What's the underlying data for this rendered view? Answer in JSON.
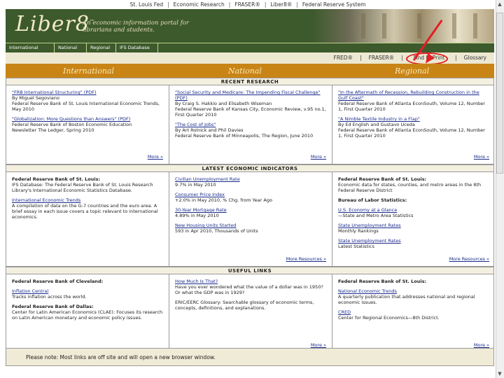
{
  "topnav": {
    "items": [
      "St. Louis Fed",
      "Economic Research",
      "FRASER®",
      "Liber8®",
      "Federal Reserve System"
    ]
  },
  "banner": {
    "logo": "Liber8",
    "logo_mark": "™",
    "tagline": "An economic information portal for librarians and students."
  },
  "tabs": [
    "International",
    "National",
    "Regional",
    "IFS Database"
  ],
  "subnav": {
    "items": [
      "FRED®",
      "FRASER®",
      "Find In Print",
      "Glossary"
    ],
    "separator": "|"
  },
  "columns": [
    "International",
    "National",
    "Regional"
  ],
  "sections": [
    {
      "title": "RECENT RESEARCH",
      "more": "More »",
      "cols": [
        [
          {
            "link": "\"FRB International Structuring\" (PDF)",
            "lines": [
              "By Miguel Segoviano",
              "Federal Reserve Bank of St. Louis International Economic Trends, May 2010"
            ]
          },
          {
            "link": "\"Globalization: More Questions than Answers\" (PDF)",
            "lines": [
              "Federal Reserve Bank of Boston Economic Education",
              "Newsletter The Ledger, Spring 2010"
            ]
          }
        ],
        [
          {
            "link": "\"Social Security and Medicare: The Impending Fiscal Challenge\" (PDF)",
            "lines": [
              "By Craig S. Hakkio and Elisabeth Wiseman",
              "Federal Reserve Bank of Kansas City, Economic Review, v.95 no.1, First Quarter 2010"
            ]
          },
          {
            "link": "\"The Cost of Jobs\"",
            "lines": [
              "By Art Rolnick and Phil Davies",
              "Federal Reserve Bank of Minneapolis, The Region, June 2010"
            ]
          }
        ],
        [
          {
            "link": "\"In the Aftermath of Recession, Rebuilding Construction in the Gulf Coast\"",
            "lines": [
              "Federal Reserve Bank of Atlanta EconSouth, Volume 12, Number 1, First Quarter 2010"
            ]
          },
          {
            "link": "\"A Nimble Textile Industry in a Flap\"",
            "lines": [
              "By Ed English and Gustavo Uceda",
              "Federal Reserve Bank of Atlanta EconSouth, Volume 12, Number 1, First Quarter 2010"
            ]
          }
        ]
      ]
    },
    {
      "title": "LATEST ECONOMIC INDICATORS",
      "more": "More Resources »",
      "cols": [
        [
          {
            "head": "Federal Reserve Bank of St. Louis:",
            "lines": [
              "IFS Database: The Federal Reserve Bank of St. Louis Research Library's International Economic Statistics Database."
            ]
          },
          {
            "link": "International Economic Trends",
            "lines": [
              "A compilation of data on the G-7 countries and the euro area. A brief essay in each issue covers a topic relevant to international economics."
            ]
          }
        ],
        [
          {
            "link": "Civilian Unemployment Rate",
            "lines": [
              "9.7% in May 2010"
            ]
          },
          {
            "link": "Consumer Price Index",
            "lines": [
              "+2.0% in May 2010, % Chg. from Year Ago"
            ]
          },
          {
            "link": "30-Year Mortgage Rate",
            "lines": [
              "4.89% in May 2010"
            ]
          },
          {
            "link": "New Housing Units Started",
            "lines": [
              "593 in Apr 2010, Thousands of Units"
            ]
          }
        ],
        [
          {
            "head": "Federal Reserve Bank of St. Louis:",
            "lines": [
              "Economic data for states, counties, and metro areas in the 8th Federal Reserve District"
            ]
          },
          {
            "head": "Bureau of Labor Statistics:",
            "lines": []
          },
          {
            "link": "U.S. Economy at a Glance",
            "lines": [
              "—State and Metro Area Statistics"
            ]
          },
          {
            "link": "State Unemployment Rates",
            "lines": [
              "Monthly Rankings"
            ]
          },
          {
            "link": "State Unemployment Rates",
            "lines": [
              "Latest Statistics"
            ]
          }
        ]
      ]
    },
    {
      "title": "USEFUL LINKS",
      "more": "More »",
      "cols": [
        [
          {
            "head": "Federal Reserve Bank of Cleveland:",
            "lines": []
          },
          {
            "link": "Inflation Central",
            "lines": [
              "Tracks inflation across the world."
            ]
          },
          {
            "head": "Federal Reserve Bank of Dallas:",
            "lines": [
              "Center for Latin American Economics (CLAE): Focuses its research on Latin American monetary and economic policy issues."
            ]
          }
        ],
        [
          {
            "link": "How Much Is That?",
            "lines": [
              "Have you ever wondered what the value of a dollar was in 1950? Or what the GDP was in 1929?"
            ]
          },
          {
            "head": "",
            "lines": [
              "ERIC/EERC Glossary: Searchable glossary of economic terms, concepts, definitions, and explanations."
            ]
          }
        ],
        [
          {
            "head": "Federal Reserve Bank of St. Louis:",
            "lines": []
          },
          {
            "link": "National Economic Trends",
            "lines": [
              "A quarterly publication that addresses national and regional economic issues."
            ]
          },
          {
            "link": "CRED",
            "lines": [
              "Center for Regional Economics—8th District."
            ]
          }
        ]
      ]
    }
  ],
  "footer": "Please note: Most links are off site and will open a new browser window."
}
